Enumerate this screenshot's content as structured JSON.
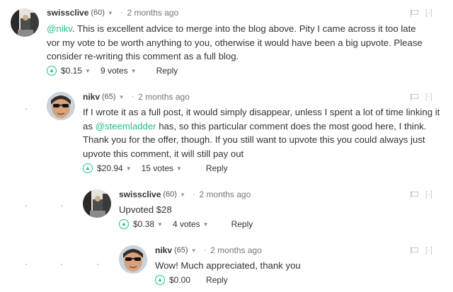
{
  "comments": [
    {
      "author": "swissclive",
      "reputation": "(60)",
      "time": "2 months ago",
      "mention": "@nikv",
      "body_after_mention": ". This is excellent advice to merge into the blog above. Pity I came across it too late vor my vote to be worth anything to you, otherwise it would have been a big upvote. Please consider re-writing this comment as a full blog.",
      "payout": "$0.15",
      "votes": "9 votes",
      "reply": "Reply",
      "flag_collapse": "[-]"
    },
    {
      "author": "nikv",
      "reputation": "(65)",
      "time": "2 months ago",
      "body_before_mention": "If I wrote it as a full post, it would simply disappear, unless I spent a lot of time linking it as ",
      "mention": "@steemladder",
      "body_after_mention": " has, so this particular comment does the most good here, I think. Thank you for the offer, though. If you still want to upvote this you could always just upvote this comment, it will still pay out",
      "payout": "$20.94",
      "votes": "15 votes",
      "reply": "Reply",
      "flag_collapse": "[-]"
    },
    {
      "author": "swissclive",
      "reputation": "(60)",
      "time": "2 months ago",
      "body": "Upvoted $28",
      "payout": "$0.38",
      "votes": "4 votes",
      "reply": "Reply",
      "flag_collapse": "[-]"
    },
    {
      "author": "nikv",
      "reputation": "(65)",
      "time": "2 months ago",
      "body": "Wow! Much appreciated, thank you",
      "payout": "$0.00",
      "reply": "Reply",
      "flag_collapse": "[-]"
    }
  ],
  "icons": {
    "upvote": "chevron-up-icon",
    "dropdown": "caret-down-icon",
    "flag": "flag-icon"
  },
  "colors": {
    "accent": "#1fbf8f",
    "text": "#333333",
    "muted": "#777777"
  }
}
